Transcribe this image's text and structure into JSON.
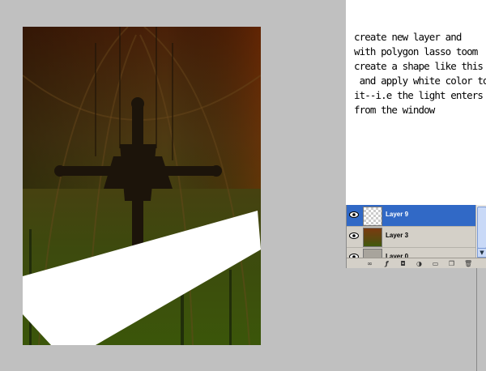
{
  "tutorial": {
    "instruction_lines": [
      "create new layer and",
      "with polygon lasso toom",
      "create a shape like this",
      " and apply white color to",
      "it--i.e the light enters",
      "from the window"
    ]
  },
  "layers_panel": {
    "layers": [
      {
        "name": "Layer 9",
        "selected": true,
        "thumbnail": "transparent"
      },
      {
        "name": "Layer 3",
        "selected": false,
        "thumbnail": "red-gradient"
      },
      {
        "name": "Layer 0",
        "selected": false,
        "thumbnail": "cross-image"
      }
    ],
    "toolbar_icons": [
      "link-icon",
      "fx-icon",
      "mask-icon",
      "adjustment-icon",
      "group-icon",
      "new-layer-icon",
      "trash-icon"
    ]
  },
  "colors": {
    "workspace": "#c0c0c0",
    "selection": "#3169c6",
    "light_shape": "#ffffff"
  }
}
